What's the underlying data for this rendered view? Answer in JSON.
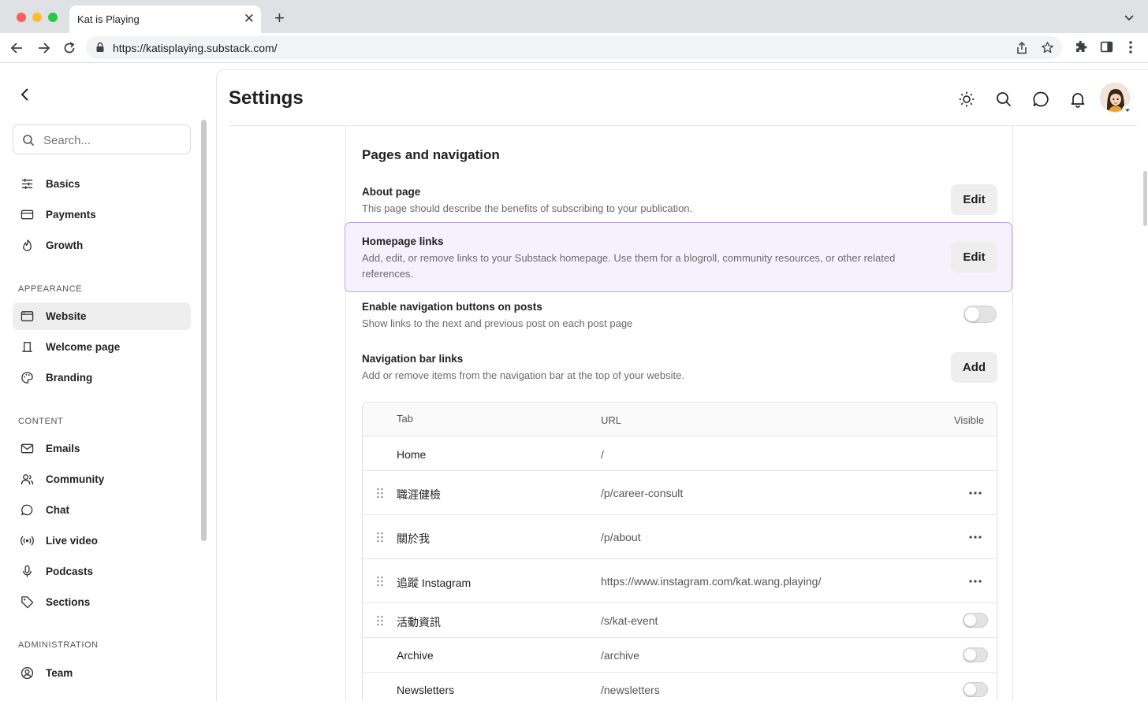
{
  "browser": {
    "tab_title": "Kat is Playing",
    "url": "https://katisplaying.substack.com/"
  },
  "sidebar": {
    "search_placeholder": "Search...",
    "items_top": [
      {
        "label": "Basics",
        "icon": "sliders-icon"
      },
      {
        "label": "Payments",
        "icon": "credit-card-icon"
      },
      {
        "label": "Growth",
        "icon": "flame-icon"
      }
    ],
    "sections": {
      "appearance": "APPEARANCE",
      "content": "CONTENT",
      "administration": "ADMINISTRATION"
    },
    "items_appearance": [
      {
        "label": "Website",
        "icon": "browser-window-icon",
        "active": true
      },
      {
        "label": "Welcome page",
        "icon": "lectern-icon"
      },
      {
        "label": "Branding",
        "icon": "palette-icon"
      }
    ],
    "items_content": [
      {
        "label": "Emails",
        "icon": "envelope-icon"
      },
      {
        "label": "Community",
        "icon": "people-icon"
      },
      {
        "label": "Chat",
        "icon": "chat-bubble-icon"
      },
      {
        "label": "Live video",
        "icon": "broadcast-icon"
      },
      {
        "label": "Podcasts",
        "icon": "microphone-icon"
      },
      {
        "label": "Sections",
        "icon": "tag-icon"
      }
    ],
    "items_admin": [
      {
        "label": "Team",
        "icon": "user-circle-icon"
      }
    ]
  },
  "header": {
    "title": "Settings"
  },
  "pages_nav": {
    "title": "Pages and navigation",
    "about": {
      "title": "About page",
      "desc": "This page should describe the benefits of subscribing to your publication.",
      "button": "Edit"
    },
    "homepage_links": {
      "title": "Homepage links",
      "desc": "Add, edit, or remove links to your Substack homepage. Use them for a blogroll, community resources, or other related references.",
      "button": "Edit"
    },
    "nav_buttons": {
      "title": "Enable navigation buttons on posts",
      "desc": "Show links to the next and previous post on each post page",
      "enabled": false
    },
    "nav_bar_links": {
      "title": "Navigation bar links",
      "desc": "Add or remove items from the navigation bar at the top of your website.",
      "button": "Add"
    },
    "table": {
      "headers": {
        "tab": "Tab",
        "url": "URL",
        "visible": "Visible"
      },
      "rows": [
        {
          "tab": "Home",
          "url": "/",
          "control": "none",
          "draggable": false
        },
        {
          "tab": "職涯健檢",
          "url": "/p/career-consult",
          "control": "more",
          "draggable": true
        },
        {
          "tab": "關於我",
          "url": "/p/about",
          "control": "more",
          "draggable": true
        },
        {
          "tab": "追蹤 Instagram",
          "url": "https://www.instagram.com/kat.wang.playing/",
          "control": "more",
          "draggable": true
        },
        {
          "tab": "活動資訊",
          "url": "/s/kat-event",
          "control": "toggle",
          "draggable": true
        },
        {
          "tab": "Archive",
          "url": "/archive",
          "control": "toggle",
          "draggable": false
        },
        {
          "tab": "Newsletters",
          "url": "/newsletters",
          "control": "toggle",
          "draggable": false
        }
      ]
    }
  },
  "colors": {
    "highlight_bg": "#f5f1fd",
    "highlight_border": "#b9a6ea",
    "active_item_bg": "#eeeeee"
  }
}
